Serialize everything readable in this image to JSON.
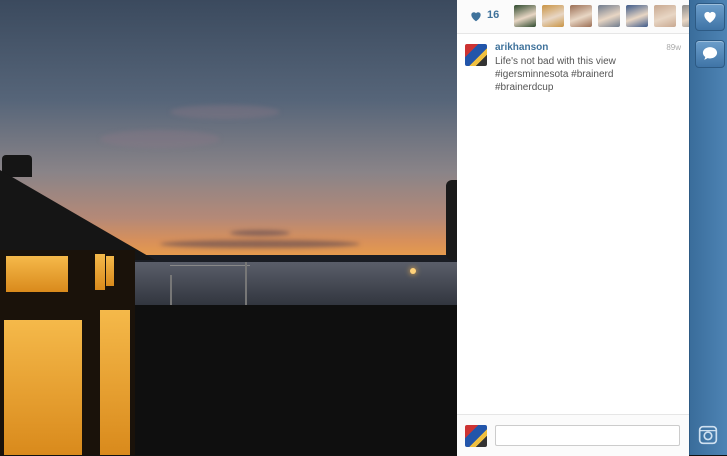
{
  "post": {
    "likes_count": "16",
    "username": "arikhanson",
    "time_ago": "89w",
    "caption": "Life's not bad with this view #igersminnesota #brainerd #brainerdcup"
  },
  "likers": [
    {
      "name": "liker-1",
      "color": "#2e4a2e"
    },
    {
      "name": "liker-2",
      "color": "#c99444"
    },
    {
      "name": "liker-3",
      "color": "#9b6e54"
    },
    {
      "name": "liker-4",
      "color": "#6f7b8d"
    },
    {
      "name": "liker-5",
      "color": "#3d5a8a"
    },
    {
      "name": "liker-6",
      "color": "#c8a890"
    },
    {
      "name": "liker-7",
      "color": "#8a8a8a"
    }
  ],
  "comment_field": {
    "placeholder": ""
  },
  "colors": {
    "link_blue": "#3f729b",
    "rail_blue": "#4e84b5"
  },
  "icons": [
    "heart-icon",
    "comment-icon",
    "instagram-icon"
  ]
}
